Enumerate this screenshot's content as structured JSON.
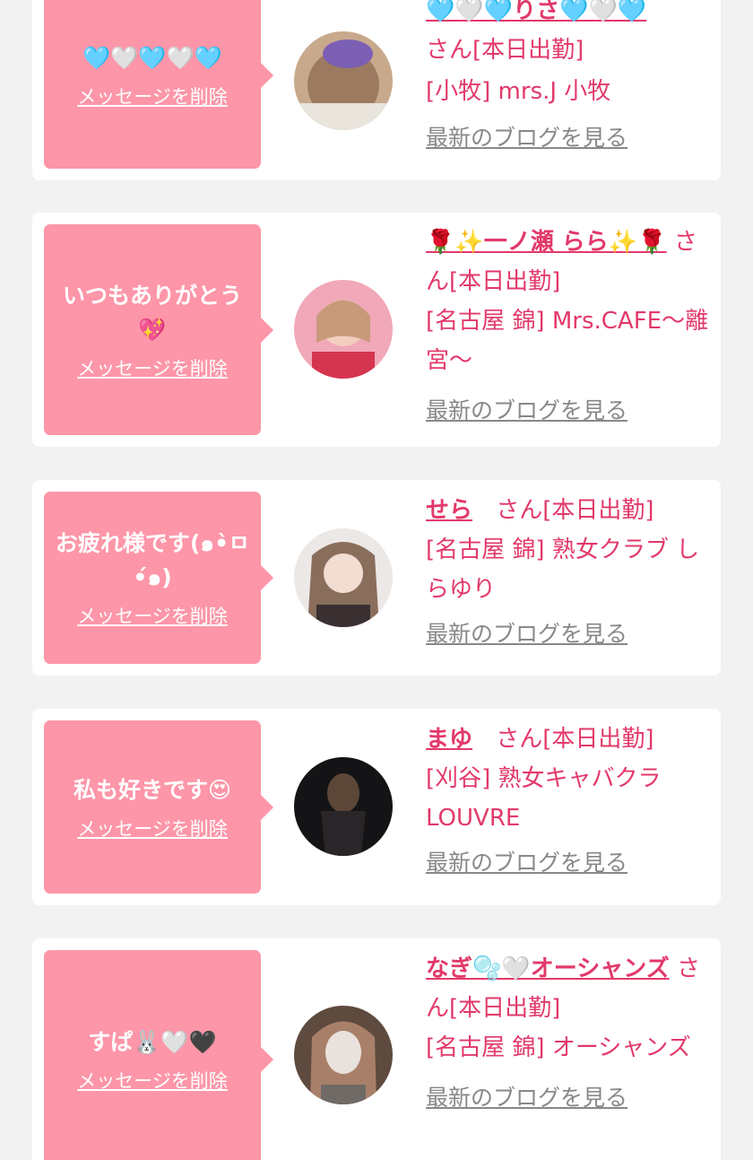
{
  "delete_label": "メッセージを削除",
  "blog_label": "最新のブログを見る",
  "suffix": "さん[本日出勤]",
  "cards": [
    {
      "message": "🩵🤍🩵🤍🩵",
      "name": "🩵🤍🩵りさ🩵🤍🩵",
      "shop": "[小牧] mrs.J 小牧",
      "avatar_color": "#9c7a60"
    },
    {
      "message": "いつもありがとう💖",
      "name": "🌹✨一ノ瀬 らら✨🌹",
      "shop": "[名古屋 錦] Mrs.CAFE〜離宮〜",
      "avatar_color": "#e6788f"
    },
    {
      "message": "お疲れ様です(๑•̀ㅁ•́๑)",
      "name": "せら",
      "shop": "[名古屋 錦] 熟女クラブ しらゆり",
      "avatar_color": "#d9d2cc"
    },
    {
      "message": "私も好きです😍",
      "name": "まゆ",
      "shop": "[刈谷] 熟女キャバクラ LOUVRE",
      "avatar_color": "#1c1b1d"
    },
    {
      "message": "すぱ🐰🤍🖤",
      "name": "なぎ🫧🤍オーシャンズ",
      "shop": "[名古屋 錦] オーシャンズ",
      "avatar_color": "#7b5b48"
    }
  ],
  "colors": {
    "bubble": "#fd96a8",
    "accent": "#e2396a",
    "link_gray": "#888888",
    "background": "#f2f2f2"
  }
}
